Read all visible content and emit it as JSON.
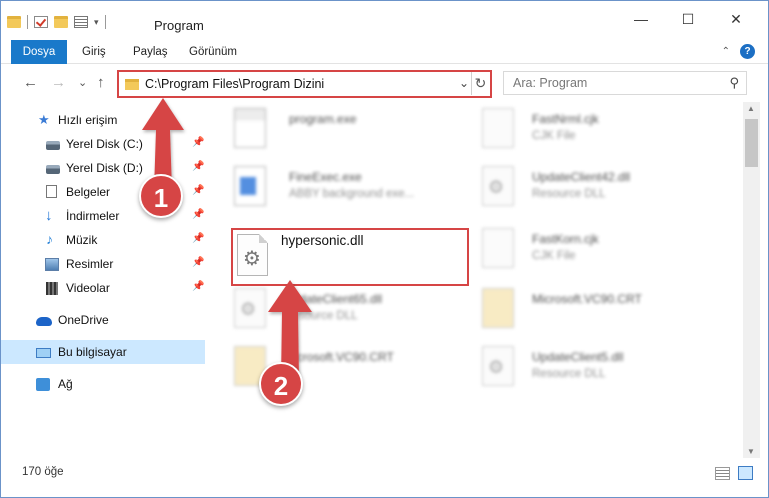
{
  "window": {
    "title": "Program",
    "minimize": "—",
    "maximize": "☐",
    "close": "✕"
  },
  "ribbon": {
    "tabs": [
      "Dosya",
      "Giriş",
      "Paylaş",
      "Görünüm"
    ],
    "help": "?",
    "collapse": "⌃",
    "accent": "#1979ca"
  },
  "address": {
    "path": "C:\\Program Files\\Program Dizini",
    "dropdown": "⌄",
    "refresh": "↻"
  },
  "search": {
    "placeholder": "Ara: Program",
    "icon": "search-icon"
  },
  "nav": {
    "back": "←",
    "forward": "→",
    "recent": "⌄",
    "up": "↑",
    "items": [
      {
        "label": "Hızlı erişim",
        "icon": "star-icon"
      },
      {
        "label": "Yerel Disk (C:)",
        "icon": "disk-icon",
        "pinned": true
      },
      {
        "label": "Yerel Disk (D:)",
        "icon": "disk-icon",
        "pinned": true
      },
      {
        "label": "Belgeler",
        "icon": "document-icon",
        "pinned": true
      },
      {
        "label": "İndirmeler",
        "icon": "download-icon",
        "pinned": true
      },
      {
        "label": "Müzik",
        "icon": "music-icon",
        "pinned": true
      },
      {
        "label": "Resimler",
        "icon": "pictures-icon",
        "pinned": true
      },
      {
        "label": "Videolar",
        "icon": "videos-icon",
        "pinned": true
      },
      {
        "label": "OneDrive",
        "icon": "cloud-icon"
      },
      {
        "label": "Bu bilgisayar",
        "icon": "computer-icon",
        "selected": true
      },
      {
        "label": "Ağ",
        "icon": "network-icon"
      }
    ]
  },
  "files": [
    {
      "name": "program.exe",
      "desc": ""
    },
    {
      "name": "FastNrml.cjk",
      "desc": "CJK File"
    },
    {
      "name": "FineExec.exe",
      "desc": "ABBY background exe..."
    },
    {
      "name": "UpdateClient42.dll",
      "desc": "Resource DLL"
    },
    {
      "name": "hypersonic.dll",
      "desc": ""
    },
    {
      "name": "FastKorn.cjk",
      "desc": "CJK File"
    },
    {
      "name": "UpdateClient65.dll",
      "desc": "Resource DLL"
    },
    {
      "name": "Microsoft.VC90.CRT",
      "desc": ""
    },
    {
      "name": "Microsoft.VC90.CRT",
      "desc": ""
    },
    {
      "name": "UpdateClient5.dll",
      "desc": "Resource DLL"
    }
  ],
  "status": {
    "count": "170 öğe"
  },
  "annotations": {
    "badge1": "1",
    "badge2": "2",
    "color": "#d64545"
  }
}
